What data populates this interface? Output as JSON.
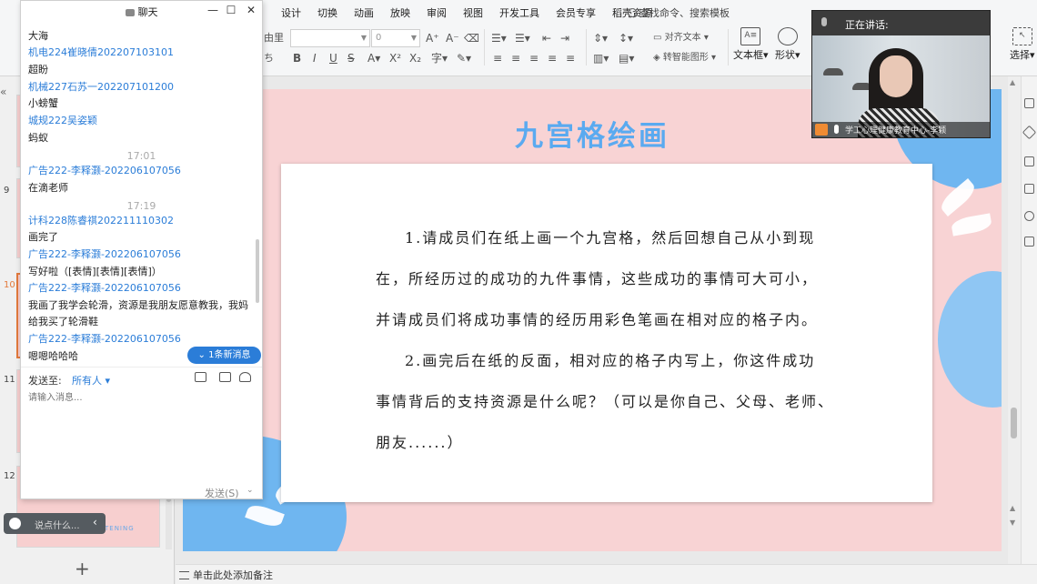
{
  "ribbon": {
    "menu_tabs": [
      "设计",
      "切换",
      "动画",
      "放映",
      "审阅",
      "视图",
      "开发工具",
      "会员专享",
      "稻壳资源"
    ],
    "search_placeholder": "查找命令、搜索模板",
    "font_size_value": "0",
    "partial_left_top": "由里",
    "partial_left_bottom": "ち",
    "align_text_label": "对齐文本",
    "smart_shape_label": "转智能图形",
    "textbox_label": "文本框",
    "shape_label": "形状",
    "select_label": "选择"
  },
  "thumbnails": {
    "numbers": [
      "9",
      "10",
      "11",
      "12"
    ],
    "caption": "TENING"
  },
  "slide": {
    "title": "九宫格绘画",
    "paragraphs": [
      "1.请成员们在纸上画一个九宫格，然后回想自己从小到现",
      "在，所经历过的成功的九件事情，这些成功的事情可大可小，",
      "并请成员们将成功事情的经历用彩色笔画在相对应的格子内。",
      "2.画完后在纸的反面，相对应的格子内写上，你这件成功",
      "事情背后的支持资源是什么呢？（可以是你自己、父母、老师、",
      "朋友......）"
    ]
  },
  "status": {
    "notes_hint": "单击此处添加备注"
  },
  "chat": {
    "title": "聊天",
    "messages": [
      {
        "kind": "text",
        "value": "大海"
      },
      {
        "kind": "name",
        "value": "机电224崔晓倩202207103101"
      },
      {
        "kind": "text",
        "value": "超盼"
      },
      {
        "kind": "name",
        "value": "机械227石苏一202207101200"
      },
      {
        "kind": "text",
        "value": "小螃蟹"
      },
      {
        "kind": "name",
        "value": "城规222吴姿颖"
      },
      {
        "kind": "text",
        "value": "蚂蚁"
      },
      {
        "kind": "time",
        "value": "17:01"
      },
      {
        "kind": "name",
        "value": "广告222-李释灏-202206107056"
      },
      {
        "kind": "text",
        "value": "在滴老师"
      },
      {
        "kind": "time",
        "value": "17:19"
      },
      {
        "kind": "name",
        "value": "计科228陈睿祺202211110302"
      },
      {
        "kind": "text",
        "value": "画完了"
      },
      {
        "kind": "name",
        "value": "广告222-李释灏-202206107056"
      },
      {
        "kind": "text",
        "value": "写好啦（[表情][表情][表情]）"
      },
      {
        "kind": "name",
        "value": "广告222-李释灏-202206107056"
      },
      {
        "kind": "text",
        "value": "我画了我学会轮滑，资源是我朋友愿意教我，我妈"
      },
      {
        "kind": "text",
        "value": "给我买了轮滑鞋"
      },
      {
        "kind": "name",
        "value": "广告222-李释灏-202206107056"
      },
      {
        "kind": "text",
        "value": "嗯嗯哈哈哈"
      }
    ],
    "new_message_badge": "1条新消息",
    "send_to_label": "发送至:",
    "send_to_value": "所有人",
    "input_placeholder": "请输入消息...",
    "send_button": "发送(S)"
  },
  "say_bar": {
    "placeholder": "说点什么..."
  },
  "video": {
    "speaking_label": "正在讲话:",
    "speaker_name": "学工心理健康教育中心-李颖"
  },
  "colors": {
    "accent_blue": "#2b7dd8",
    "title_blue": "#5aaaf0",
    "slide_pink": "#f8d3d4",
    "active_orange": "#e37a3c"
  }
}
